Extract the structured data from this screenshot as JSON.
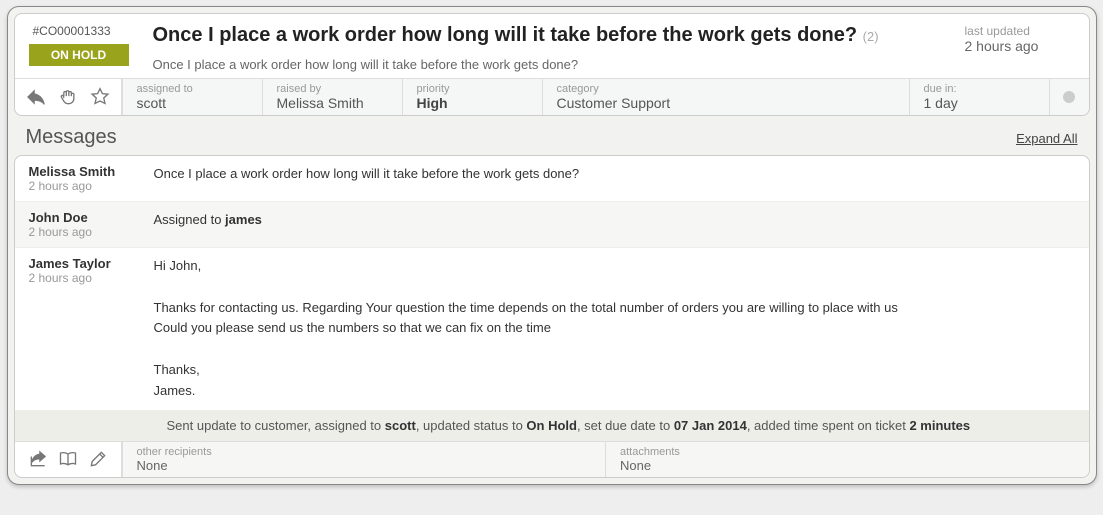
{
  "ticket": {
    "id": "#CO00001333",
    "status": "ON HOLD",
    "title": "Once I place a work order how long will it take before the work gets done?",
    "reply_count": "(2)",
    "subtitle": "Once I place a work order how long will it take before the work gets done?",
    "last_updated_label": "last updated",
    "last_updated_value": "2 hours ago"
  },
  "meta": {
    "assigned_to_label": "assigned to",
    "assigned_to_value": "scott",
    "raised_by_label": "raised by",
    "raised_by_value": "Melissa Smith",
    "priority_label": "priority",
    "priority_value": "High",
    "category_label": "category",
    "category_value": "Customer Support",
    "due_label": "due in:",
    "due_value": "1 day"
  },
  "messages_section": {
    "heading": "Messages",
    "expand_all": "Expand All"
  },
  "messages": [
    {
      "author": "Melissa Smith",
      "time": "2 hours ago",
      "body_prefix": "Once I place a work order how long will it take before the work gets done?",
      "body_bold": "",
      "alt": false
    },
    {
      "author": "John Doe",
      "time": "2 hours ago",
      "body_prefix": "Assigned to ",
      "body_bold": "james",
      "alt": true
    }
  ],
  "long_message": {
    "author": "James Taylor",
    "time": "2 hours ago",
    "greeting": "Hi John,",
    "para1": "Thanks for contacting us. Regarding Your question the time depends on the total number of orders you are willing to place with us",
    "para2": "Could you please send us the numbers so that we can fix on the time",
    "signoff1": "Thanks,",
    "signoff2": "James."
  },
  "update_note": {
    "t1": "Sent update to customer, assigned to ",
    "b1": "scott",
    "t2": ", updated status to ",
    "b2": "On Hold",
    "t3": ", set due date to ",
    "b3": "07 Jan 2014",
    "t4": ", added time spent on ticket ",
    "b4": "2 minutes"
  },
  "footer": {
    "recipients_label": "other recipients",
    "recipients_value": "None",
    "attachments_label": "attachments",
    "attachments_value": "None"
  }
}
